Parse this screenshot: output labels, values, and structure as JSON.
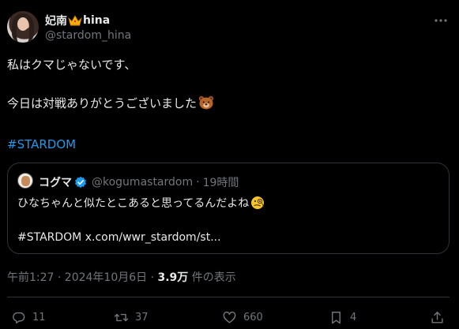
{
  "author": {
    "name_part1": "妃南",
    "name_part2": "hina",
    "handle": "@stardom_hina"
  },
  "tweet": {
    "line1": "私はクマじゃないです、",
    "line2": "今日は対戦ありがとうございました",
    "hashtag": "#STARDOM"
  },
  "quote": {
    "name": "コグマ",
    "handle": "@kogumastardom",
    "separator": "·",
    "time": "19時間",
    "line1": "ひなちゃんと似たとこあると思ってるんだよね",
    "hashtag": "#STARDOM",
    "link": "x.com/wwr_stardom/st..."
  },
  "meta": {
    "timestamp": "午前1:27 · 2024年10月6日 ·",
    "views_count": "3.9万",
    "views_label": "件の表示"
  },
  "actions": {
    "replies": "11",
    "retweets": "37",
    "likes": "660",
    "bookmarks": "4"
  },
  "colors": {
    "background": "#000000",
    "text": "#e7e9ea",
    "secondary": "#71767b",
    "accent": "#1d9bf0",
    "border": "#2f3336"
  },
  "icons": [
    "crown-icon",
    "more-icon",
    "bear-emoji-icon",
    "verified-icon",
    "thinking-emoji-icon",
    "reply-icon",
    "retweet-icon",
    "like-icon",
    "bookmark-icon",
    "share-icon"
  ]
}
